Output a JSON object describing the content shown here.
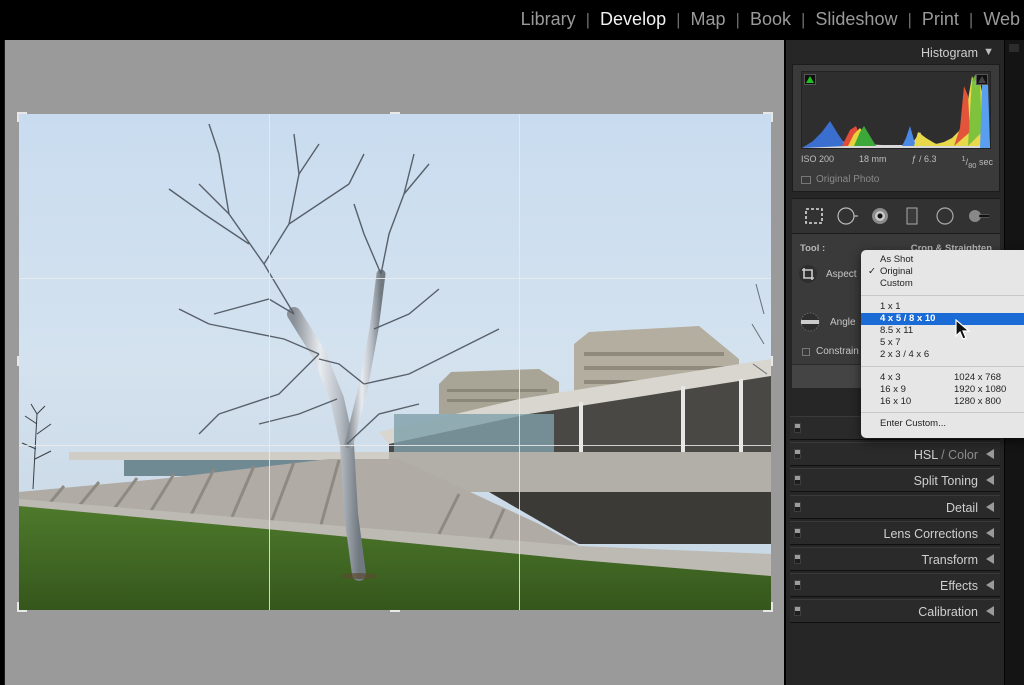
{
  "modules": {
    "items": [
      {
        "label": "Library",
        "active": false
      },
      {
        "label": "Develop",
        "active": true
      },
      {
        "label": "Map",
        "active": false
      },
      {
        "label": "Book",
        "active": false
      },
      {
        "label": "Slideshow",
        "active": false
      },
      {
        "label": "Print",
        "active": false
      },
      {
        "label": "Web",
        "active": false
      }
    ],
    "separator": "|"
  },
  "histogram": {
    "title": "Histogram",
    "collapse_icon": "triangle-down-icon",
    "iso": "ISO 200",
    "focal_length": "18 mm",
    "aperture": "ƒ / 6.3",
    "shutter": "1/80 sec",
    "shutter_num": "1",
    "shutter_den": "80",
    "shutter_unit": "sec",
    "original_photo_label": "Original Photo",
    "original_photo_checked": false
  },
  "tool_strip": {
    "tools": [
      {
        "name": "crop-overlay-icon",
        "active": true
      },
      {
        "name": "spot-removal-icon",
        "active": false
      },
      {
        "name": "red-eye-icon",
        "active": false
      },
      {
        "name": "graduated-filter-icon",
        "active": false
      },
      {
        "name": "radial-filter-icon",
        "active": false
      },
      {
        "name": "adjustment-brush-icon",
        "active": false
      }
    ]
  },
  "crop": {
    "tool_label": "Tool :",
    "tool_value": "Crop & Straighten",
    "aspect_label": "Aspect",
    "angle_label": "Angle",
    "constrain_label": "Constrain",
    "constrain_checked": false
  },
  "aspect_menu": {
    "groups": [
      [
        {
          "label": "As Shot",
          "checked": false
        },
        {
          "label": "Original",
          "checked": true
        },
        {
          "label": "Custom",
          "checked": false
        }
      ],
      [
        {
          "label": "1 x 1"
        },
        {
          "label": "4 x 5  /  8 x 10",
          "selected": true
        },
        {
          "label": "8.5 x 11"
        },
        {
          "label": "5 x 7"
        },
        {
          "label": "2 x 3  /  4 x 6"
        }
      ],
      [
        {
          "label": "4 x 3",
          "right": "1024 x 768"
        },
        {
          "label": "16 x 9",
          "right": "1920 x 1080"
        },
        {
          "label": "16 x 10",
          "right": "1280 x 800"
        }
      ],
      [
        {
          "label": "Enter Custom..."
        }
      ]
    ],
    "selected_color": "#1a6bd6"
  },
  "panels": [
    {
      "label": "",
      "collapsed": true
    },
    {
      "label": "HSL",
      "label_dim": " / Color",
      "collapsed": true
    },
    {
      "label": "Split Toning",
      "collapsed": true
    },
    {
      "label": "Detail",
      "collapsed": true
    },
    {
      "label": "Lens Corrections",
      "collapsed": true
    },
    {
      "label": "Transform",
      "collapsed": true
    },
    {
      "label": "Effects",
      "collapsed": true
    },
    {
      "label": "Calibration",
      "collapsed": true
    }
  ],
  "photo": {
    "description": "Silver sculptural tree on grass slope in front of modern concrete building with glass pavilion, apartment blocks behind, overcast sky",
    "crop_overlay": "rule-of-thirds grid"
  },
  "colors": {
    "active_module": "#f2f2f2",
    "inactive_module": "#9a9a9a",
    "panel_bg": "#262626",
    "canvas_bg": "#9a9a9a",
    "menu_highlight": "#1a6bd6"
  }
}
